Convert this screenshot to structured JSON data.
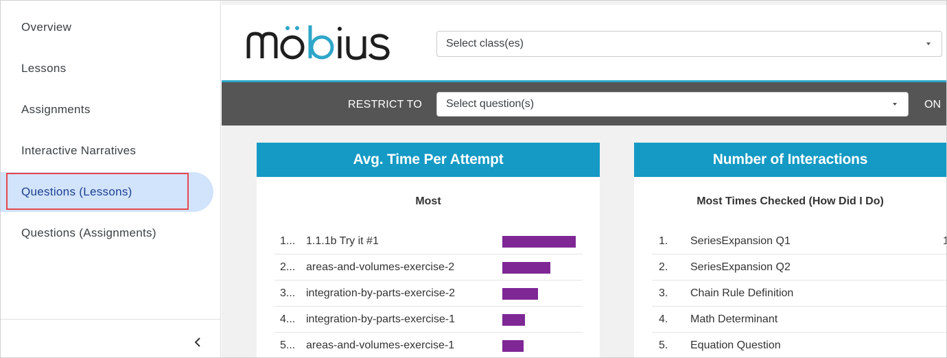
{
  "sidebar": {
    "items": [
      {
        "label": "Overview",
        "active": false
      },
      {
        "label": "Lessons",
        "active": false
      },
      {
        "label": "Assignments",
        "active": false
      },
      {
        "label": "Interactive Narratives",
        "active": false
      },
      {
        "label": "Questions (Lessons)",
        "active": true
      },
      {
        "label": "Questions (Assignments)",
        "active": false
      }
    ],
    "collapse_icon": "chevron-left-icon"
  },
  "header": {
    "logo_text": "möbius",
    "class_select_placeholder": "Select class(es)"
  },
  "toolbar": {
    "restrict_label": "RESTRICT TO",
    "question_select_placeholder": "Select question(s)",
    "on_label": "ON"
  },
  "cards": {
    "avg_time": {
      "title": "Avg. Time Per Attempt",
      "subtitle": "Most",
      "bar_color": "#7e2795",
      "rows": [
        {
          "num": "1...",
          "label": "1.1.1b Try it #1",
          "value": 1.0
        },
        {
          "num": "2...",
          "label": "areas-and-volumes-exercise-2",
          "value": 0.65
        },
        {
          "num": "3...",
          "label": "integration-by-parts-exercise-2",
          "value": 0.49
        },
        {
          "num": "4...",
          "label": "integration-by-parts-exercise-1",
          "value": 0.31
        },
        {
          "num": "5...",
          "label": "areas-and-volumes-exercise-1",
          "value": 0.29
        }
      ]
    },
    "interactions": {
      "title": "Number of Interactions",
      "subtitle": "Most Times Checked (How Did I Do)",
      "rows": [
        {
          "num": "1.",
          "label": "SeriesExpansion Q1",
          "value_text": "1"
        },
        {
          "num": "2.",
          "label": "SeriesExpansion Q2",
          "value_text": ""
        },
        {
          "num": "3.",
          "label": "Chain Rule Definition",
          "value_text": ""
        },
        {
          "num": "4.",
          "label": "Math Determinant",
          "value_text": ""
        },
        {
          "num": "5.",
          "label": "Equation Question",
          "value_text": ""
        }
      ]
    }
  },
  "colors": {
    "accent": "#149ac4",
    "toolbar_bg": "#555555",
    "active_nav_bg": "#d2e3fc",
    "highlight_outline": "#e5474b"
  }
}
